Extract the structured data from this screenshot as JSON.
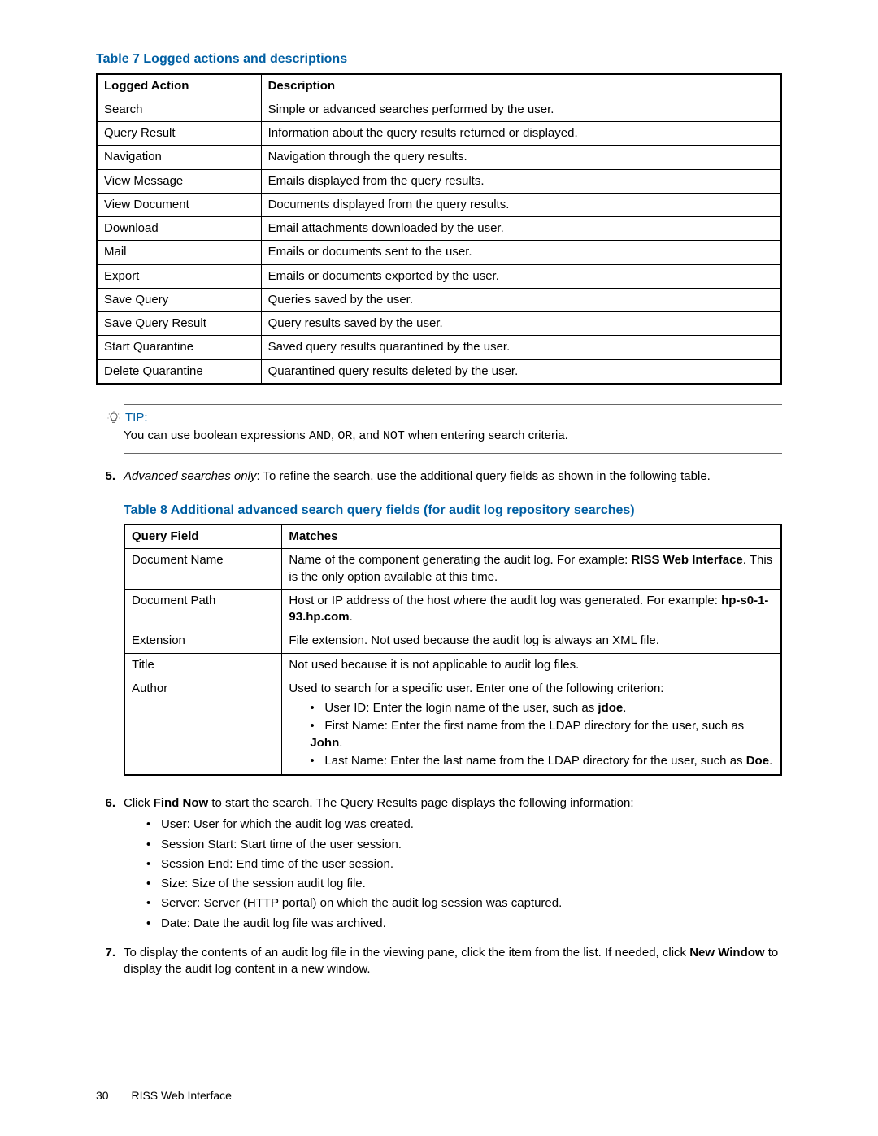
{
  "table7": {
    "title": "Table 7 Logged actions and descriptions",
    "headers": {
      "c1": "Logged Action",
      "c2": "Description"
    },
    "rows": [
      {
        "c1": "Search",
        "c2": "Simple or advanced searches performed by the user."
      },
      {
        "c1": "Query Result",
        "c2": "Information about the query results returned or displayed."
      },
      {
        "c1": "Navigation",
        "c2": "Navigation through the query results."
      },
      {
        "c1": "View Message",
        "c2": "Emails displayed from the query results."
      },
      {
        "c1": "View Document",
        "c2": "Documents displayed from the query results."
      },
      {
        "c1": "Download",
        "c2": "Email attachments downloaded by the user."
      },
      {
        "c1": "Mail",
        "c2": "Emails or documents sent to the user."
      },
      {
        "c1": "Export",
        "c2": "Emails or documents exported by the user."
      },
      {
        "c1": "Save Query",
        "c2": "Queries saved by the user."
      },
      {
        "c1": "Save Query Result",
        "c2": "Query results saved by the user."
      },
      {
        "c1": "Start Quarantine",
        "c2": "Saved query results quarantined by the user."
      },
      {
        "c1": "Delete Quarantine",
        "c2": "Quarantined query results deleted by the user."
      }
    ]
  },
  "tip": {
    "label": "TIP:",
    "text_pre": "You can use boolean expressions ",
    "code1": "AND",
    "comma1": ", ",
    "code2": "OR",
    "mid": ", and ",
    "code3": "NOT",
    "text_post": " when entering search criteria."
  },
  "step5": {
    "num": "5.",
    "lead_italic": "Advanced searches only",
    "lead_after": ": To refine the search, use the additional query fields as shown in the following table."
  },
  "table8": {
    "title": "Table 8 Additional advanced search query fields (for audit log repository searches)",
    "headers": {
      "c1": "Query Field",
      "c2": "Matches"
    },
    "rows": {
      "docname": {
        "c1": "Document Name",
        "pre": "Name of the component generating the audit log. For example: ",
        "bold": "RISS Web Interface",
        "post": ". This is the only option available at this time."
      },
      "docpath": {
        "c1": "Document Path",
        "pre": "Host or IP address of the host where the audit log was generated. For example: ",
        "bold": "hp-s0-1-93.hp.com",
        "post": "."
      },
      "extension": {
        "c1": "Extension",
        "c2": "File extension. Not used because the audit log is always an XML file."
      },
      "title": {
        "c1": "Title",
        "c2": "Not used because it is not applicable to audit log files."
      },
      "author": {
        "c1": "Author",
        "intro": "Used to search for a specific user. Enter one of the following criterion:",
        "bullets": {
          "b1_pre": "User ID: Enter the login name of the user, such as ",
          "b1_bold": "jdoe",
          "b1_post": ".",
          "b2_pre": "First Name: Enter the first name from the LDAP directory for the user, such as ",
          "b2_bold": "John",
          "b2_post": ".",
          "b3_pre": "Last Name: Enter the last name from the LDAP directory for the user, such as ",
          "b3_bold": "Doe",
          "b3_post": "."
        }
      }
    }
  },
  "step6": {
    "num": "6.",
    "pre": "Click ",
    "bold": "Find Now",
    "post": " to start the search. The Query Results page displays the following information:",
    "items": [
      "User: User for which the audit log was created.",
      "Session Start: Start time of the user session.",
      "Session End: End time of the user session.",
      "Size: Size of the session audit log file.",
      "Server: Server (HTTP portal) on which the audit log session was captured.",
      "Date: Date the audit log file was archived."
    ]
  },
  "step7": {
    "num": "7.",
    "pre": "To display the contents of an audit log file in the viewing pane, click the item from the list. If needed, click ",
    "bold": "New Window",
    "post": " to display the audit log content in a new window."
  },
  "footer": {
    "page": "30",
    "section": "RISS Web Interface"
  }
}
